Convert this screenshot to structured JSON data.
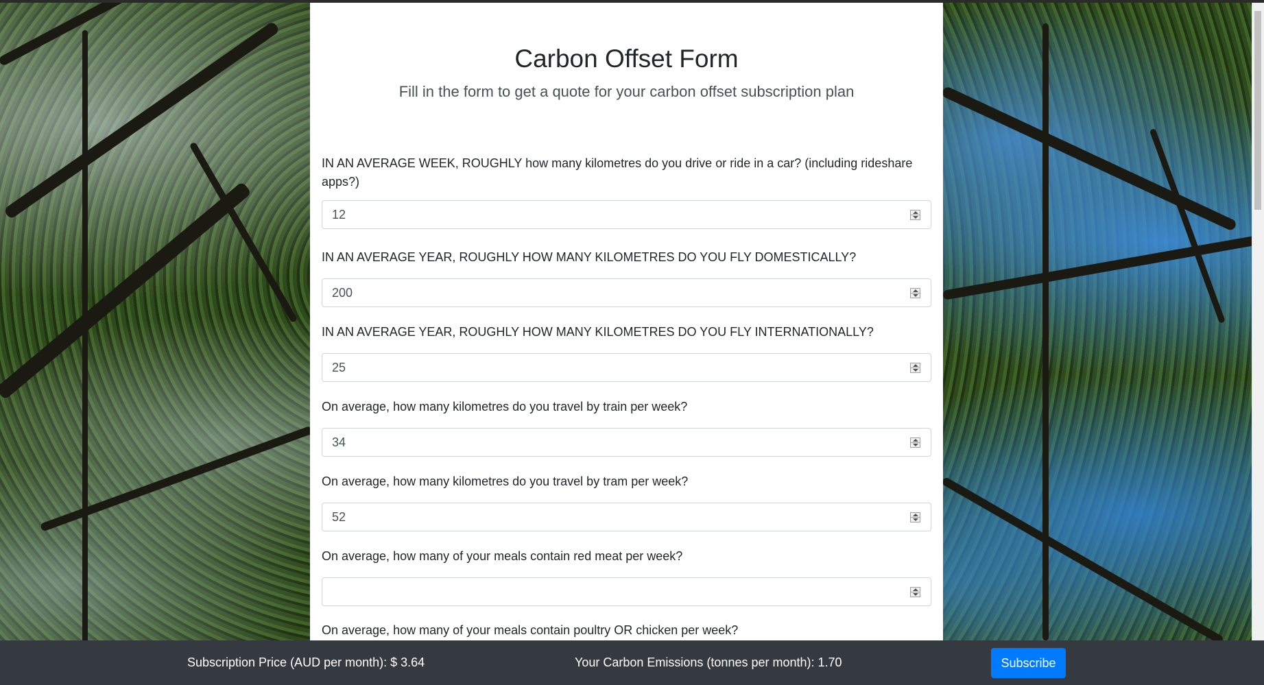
{
  "page": {
    "title": "Carbon Offset Form",
    "subtitle": "Fill in the form to get a quote for your carbon offset subscription plan"
  },
  "questions": [
    {
      "label": "IN AN AVERAGE WEEK, ROUGHLY how many kilometres do you drive or ride in a car? (including rideshare apps?)",
      "value": "12"
    },
    {
      "label": "IN AN AVERAGE YEAR, ROUGHLY HOW MANY KILOMETRES DO YOU FLY DOMESTICALLY?",
      "value": "200"
    },
    {
      "label": "IN AN AVERAGE YEAR, ROUGHLY HOW MANY KILOMETRES DO YOU FLY INTERNATIONALLY?",
      "value": "25"
    },
    {
      "label": "On average, how many kilometres do you travel by train per week?",
      "value": "34"
    },
    {
      "label": "On average, how many kilometres do you travel by tram per week?",
      "value": "52"
    },
    {
      "label": "On average, how many of your meals contain red meat per week?",
      "value": ""
    },
    {
      "label": "On average, how many of your meals contain poultry OR chicken per week?",
      "value": ""
    }
  ],
  "footer": {
    "price_text": "Subscription Price (AUD per month): $ 3.64",
    "emissions_text": "Your Carbon Emissions (tonnes per month): 1.70",
    "subscribe_label": "Subscribe"
  },
  "colors": {
    "footer_bg": "#343a40",
    "primary_button": "#007bff",
    "card_bg": "#ffffff"
  }
}
